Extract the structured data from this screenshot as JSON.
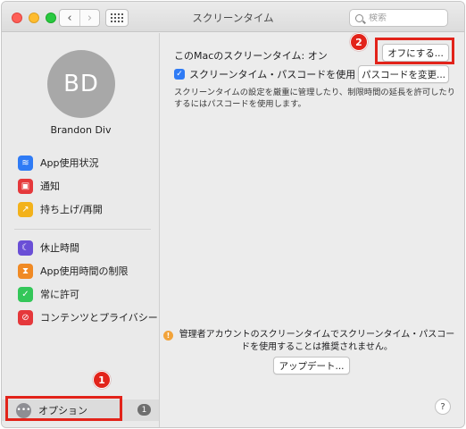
{
  "window": {
    "title": "スクリーンタイム"
  },
  "toolbar": {
    "back_glyph": "‹",
    "forward_glyph": "›"
  },
  "search": {
    "placeholder": "検索"
  },
  "user": {
    "initials": "BD",
    "name": "Brandon Div"
  },
  "sidebar": {
    "group1": [
      {
        "label": "App使用状況",
        "icon": "stack-layers-icon",
        "color": "#2f7bf5",
        "glyph": "≋"
      },
      {
        "label": "通知",
        "icon": "notification-icon",
        "color": "#e5383b",
        "glyph": "▣"
      },
      {
        "label": "持ち上げ/再開",
        "icon": "pickup-icon",
        "color": "#f3b21b",
        "glyph": "↗"
      }
    ],
    "group2": [
      {
        "label": "休止時間",
        "icon": "downtime-moon-icon",
        "color": "#6a4fd6",
        "glyph": "☾"
      },
      {
        "label": "App使用時間の制限",
        "icon": "hourglass-icon",
        "color": "#f08a24",
        "glyph": "⧗"
      },
      {
        "label": "常に許可",
        "icon": "checkmark-icon",
        "color": "#34c759",
        "glyph": "✓"
      },
      {
        "label": "コンテンツとプライバシー",
        "icon": "restricted-icon",
        "color": "#e5383b",
        "glyph": "⊘"
      }
    ],
    "options": {
      "label": "オプション",
      "badge": "1",
      "icon": "options-ellipsis-icon"
    }
  },
  "main": {
    "status_text": "このMacのスクリーンタイム: オン",
    "turn_off_button": "オフにする...",
    "passcode_checkbox_label": "スクリーンタイム・パスコードを使用",
    "passcode_checked": true,
    "change_passcode_button": "パスコードを変更...",
    "description": "スクリーンタイムの設定を厳重に管理したり、制限時間の延長を許可したりするにはパスコードを使用します。",
    "warning_text": "管理者アカウントのスクリーンタイムでスクリーンタイム・パスコードを使用することは推奨されません。",
    "update_button": "アップデート...",
    "help_label": "?"
  },
  "annotations": {
    "marker1": "1",
    "marker2": "2",
    "highlight_color": "#e2231a"
  }
}
